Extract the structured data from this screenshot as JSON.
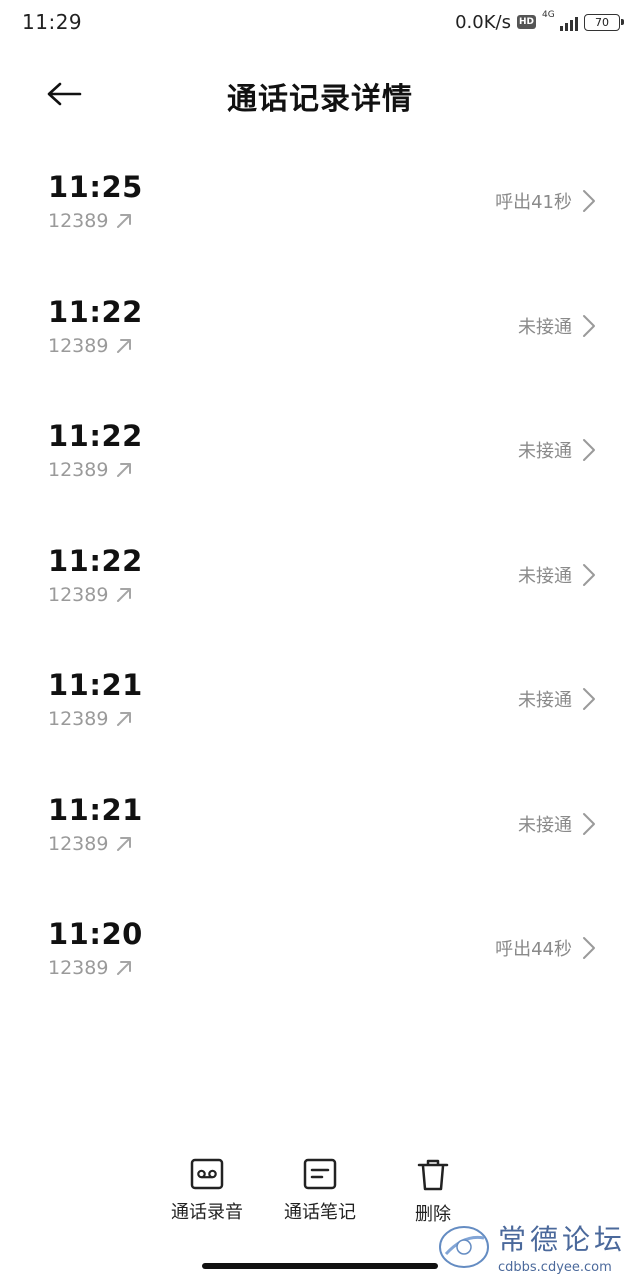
{
  "status_bar": {
    "time": "11:29",
    "net_speed": "0.0K/s",
    "hd_badge": "HD",
    "network_type": "4G",
    "battery": "70"
  },
  "header": {
    "back_icon": "arrow-left-icon",
    "title": "通话记录详情"
  },
  "records": [
    {
      "time": "11:25",
      "number": "12389",
      "direction_icon": "outgoing-arrow-icon",
      "status": "呼出41秒"
    },
    {
      "time": "11:22",
      "number": "12389",
      "direction_icon": "outgoing-arrow-icon",
      "status": "未接通"
    },
    {
      "time": "11:22",
      "number": "12389",
      "direction_icon": "outgoing-arrow-icon",
      "status": "未接通"
    },
    {
      "time": "11:22",
      "number": "12389",
      "direction_icon": "outgoing-arrow-icon",
      "status": "未接通"
    },
    {
      "time": "11:21",
      "number": "12389",
      "direction_icon": "outgoing-arrow-icon",
      "status": "未接通"
    },
    {
      "time": "11:21",
      "number": "12389",
      "direction_icon": "outgoing-arrow-icon",
      "status": "未接通"
    },
    {
      "time": "11:20",
      "number": "12389",
      "direction_icon": "outgoing-arrow-icon",
      "status": "呼出44秒"
    }
  ],
  "actions": {
    "recording": {
      "label": "通话录音",
      "icon": "voicemail-tape-icon"
    },
    "notes": {
      "label": "通话笔记",
      "icon": "note-icon"
    },
    "delete": {
      "label": "删除",
      "icon": "trash-icon"
    }
  },
  "watermark": {
    "title": "常德论坛",
    "url": "cdbbs.cdyee.com"
  },
  "colors": {
    "text_primary": "#111111",
    "text_secondary": "#9a9a9a",
    "background": "#ffffff",
    "watermark": "#2c4f8a"
  }
}
